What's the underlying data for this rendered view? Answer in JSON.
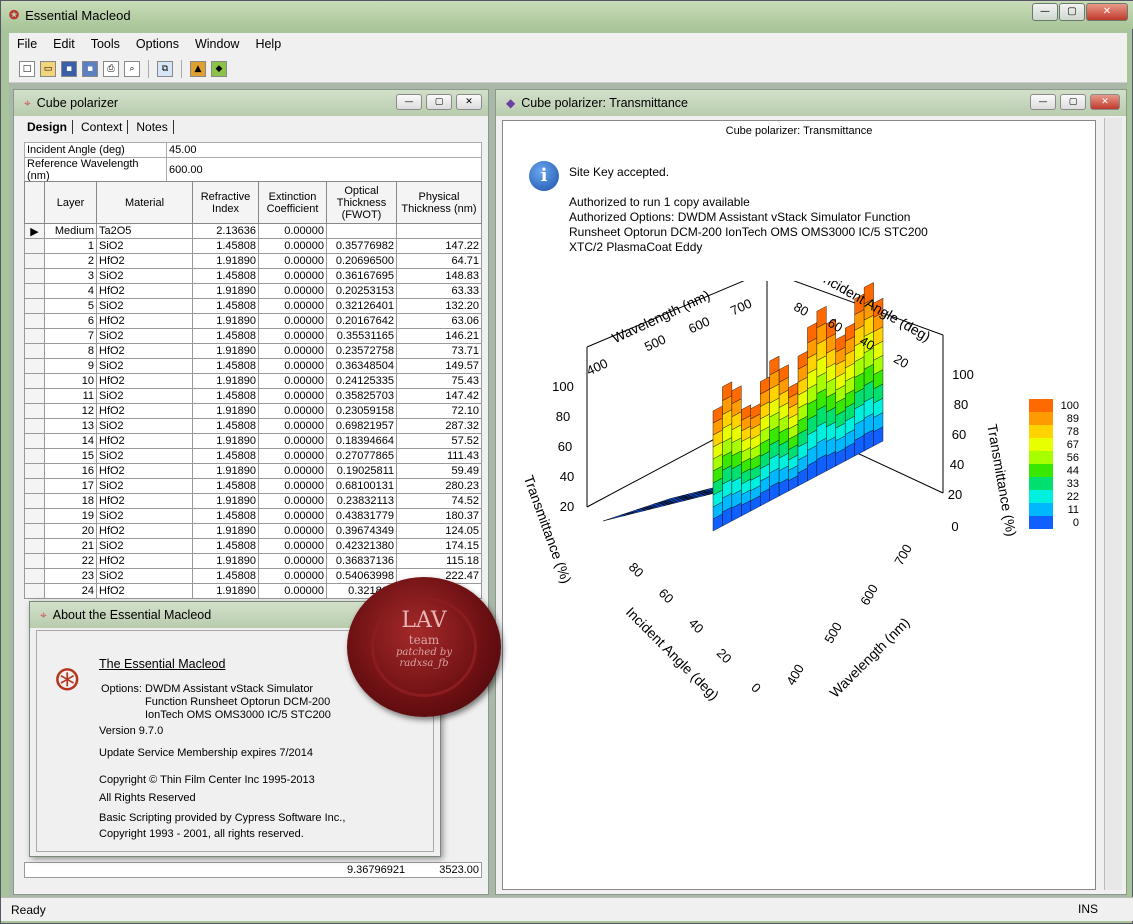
{
  "app": {
    "title": "Essential Macleod"
  },
  "menu": [
    "File",
    "Edit",
    "Tools",
    "Options",
    "Window",
    "Help"
  ],
  "design_window": {
    "title": "Cube polarizer",
    "tabs": [
      "Design",
      "Context",
      "Notes"
    ],
    "params": [
      {
        "label": "Incident Angle (deg)",
        "value": "45.00"
      },
      {
        "label": "Reference Wavelength (nm)",
        "value": "600.00"
      }
    ],
    "columns": [
      "Layer",
      "Material",
      "Refractive Index",
      "Extinction Coefficient",
      "Optical Thickness (FWOT)",
      "Physical Thickness (nm)"
    ],
    "rows": [
      [
        "Medium",
        "Ta2O5",
        "2.13636",
        "0.00000",
        "",
        ""
      ],
      [
        "1",
        "SiO2",
        "1.45808",
        "0.00000",
        "0.35776982",
        "147.22"
      ],
      [
        "2",
        "HfO2",
        "1.91890",
        "0.00000",
        "0.20696500",
        "64.71"
      ],
      [
        "3",
        "SiO2",
        "1.45808",
        "0.00000",
        "0.36167695",
        "148.83"
      ],
      [
        "4",
        "HfO2",
        "1.91890",
        "0.00000",
        "0.20253153",
        "63.33"
      ],
      [
        "5",
        "SiO2",
        "1.45808",
        "0.00000",
        "0.32126401",
        "132.20"
      ],
      [
        "6",
        "HfO2",
        "1.91890",
        "0.00000",
        "0.20167642",
        "63.06"
      ],
      [
        "7",
        "SiO2",
        "1.45808",
        "0.00000",
        "0.35531165",
        "146.21"
      ],
      [
        "8",
        "HfO2",
        "1.91890",
        "0.00000",
        "0.23572758",
        "73.71"
      ],
      [
        "9",
        "SiO2",
        "1.45808",
        "0.00000",
        "0.36348504",
        "149.57"
      ],
      [
        "10",
        "HfO2",
        "1.91890",
        "0.00000",
        "0.24125335",
        "75.43"
      ],
      [
        "11",
        "SiO2",
        "1.45808",
        "0.00000",
        "0.35825703",
        "147.42"
      ],
      [
        "12",
        "HfO2",
        "1.91890",
        "0.00000",
        "0.23059158",
        "72.10"
      ],
      [
        "13",
        "SiO2",
        "1.45808",
        "0.00000",
        "0.69821957",
        "287.32"
      ],
      [
        "14",
        "HfO2",
        "1.91890",
        "0.00000",
        "0.18394664",
        "57.52"
      ],
      [
        "15",
        "SiO2",
        "1.45808",
        "0.00000",
        "0.27077865",
        "111.43"
      ],
      [
        "16",
        "HfO2",
        "1.91890",
        "0.00000",
        "0.19025811",
        "59.49"
      ],
      [
        "17",
        "SiO2",
        "1.45808",
        "0.00000",
        "0.68100131",
        "280.23"
      ],
      [
        "18",
        "HfO2",
        "1.91890",
        "0.00000",
        "0.23832113",
        "74.52"
      ],
      [
        "19",
        "SiO2",
        "1.45808",
        "0.00000",
        "0.43831779",
        "180.37"
      ],
      [
        "20",
        "HfO2",
        "1.91890",
        "0.00000",
        "0.39674349",
        "124.05"
      ],
      [
        "21",
        "SiO2",
        "1.45808",
        "0.00000",
        "0.42321380",
        "174.15"
      ],
      [
        "22",
        "HfO2",
        "1.91890",
        "0.00000",
        "0.36837136",
        "115.18"
      ],
      [
        "23",
        "SiO2",
        "1.45808",
        "0.00000",
        "0.54063998",
        "222.47"
      ],
      [
        "24",
        "HfO2",
        "1.91890",
        "0.00000",
        "0.321815",
        ""
      ]
    ],
    "totals": {
      "optical": "9.36796921",
      "physical": "3523.00"
    }
  },
  "about": {
    "title": "About the Essential Macleod",
    "product": "The Essential Macleod",
    "options_label": "Options:",
    "options_lines": [
      "DWDM Assistant vStack Simulator",
      "Function Runsheet Optorun DCM-200",
      "IonTech OMS OMS3000 IC/5 STC200"
    ],
    "version": "Version 9.7.0",
    "membership": "Update Service Membership expires 7/2014",
    "copyright": "Copyright © Thin Film Center Inc 1995-2013",
    "rights": "All Rights Reserved",
    "scripting": "Basic Scripting provided by Cypress Software Inc.,",
    "scripting_copy": "Copyright 1993 - 2001, all rights reserved."
  },
  "seal": {
    "text1": "LAV",
    "text2": "team",
    "text3": "patched by",
    "text4": "radxsa_fb"
  },
  "chart_window": {
    "title": "Cube polarizer: Transmittance",
    "plot_title": "Cube polarizer: Transmittance",
    "site_key": "Site Key accepted.",
    "auth_lines": [
      "Authorized to run 1 copy available",
      "Authorized Options: DWDM Assistant vStack Simulator Function",
      "Runsheet Optorun DCM-200 IonTech OMS OMS3000 IC/5 STC200",
      "XTC/2 PlasmaCoat Eddy"
    ]
  },
  "chart_data": {
    "type": "surface3d",
    "title": "Cube polarizer: Transmittance",
    "x_label": "Wavelength (nm)",
    "y_label": "Incident Angle (deg)",
    "z_label": "Transmittance (%)",
    "x_ticks": [
      "400",
      "500",
      "600",
      "700"
    ],
    "y_ticks": [
      "0",
      "20",
      "40",
      "60",
      "80"
    ],
    "y_ticks_back": [
      "20",
      "40",
      "60",
      "80"
    ],
    "z_ticks": [
      "0",
      "20",
      "40",
      "60",
      "80",
      "100"
    ],
    "colorbar": [
      "100",
      "89",
      "78",
      "67",
      "56",
      "44",
      "33",
      "22",
      "11",
      "0"
    ],
    "colors": [
      "#ff6a00",
      "#ff9a00",
      "#ffd200",
      "#e8ff00",
      "#a8ff00",
      "#38e800",
      "#00e070",
      "#00f0e0",
      "#00b8ff",
      "#1060ff"
    ]
  },
  "status": {
    "left": "Ready",
    "right": "INS"
  }
}
